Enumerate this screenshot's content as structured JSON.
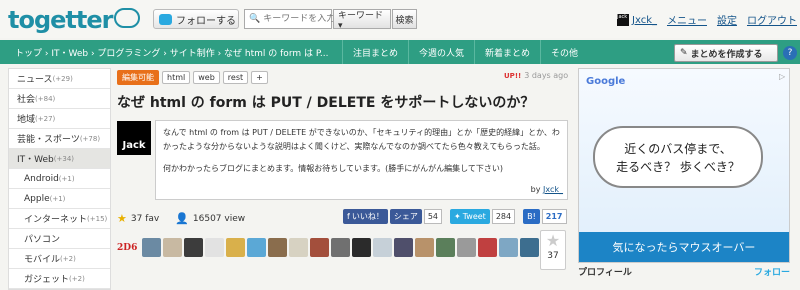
{
  "header": {
    "logo": "togetter",
    "follow": "フォローする",
    "search_placeholder": "キーワードを入力",
    "search_type": "キーワード ▾",
    "search_btn": "検索",
    "user_avatar": "Jack",
    "user_name": "Jxck_",
    "menu": "メニュー",
    "settings": "設定",
    "logout": "ログアウト"
  },
  "nav": {
    "breadcrumb": "トップ › IT・Web › プログラミング › サイト制作 › なぜ html の form は P...",
    "items": [
      "注目まとめ",
      "今週の人気",
      "新着まとめ",
      "その他"
    ],
    "create": "まとめを作成する",
    "help": "?"
  },
  "sidebar": [
    {
      "label": "ニュース",
      "count": "(+29)"
    },
    {
      "label": "社会",
      "count": "(+84)"
    },
    {
      "label": "地域",
      "count": "(+27)"
    },
    {
      "label": "芸能・スポーツ",
      "count": "(+78)"
    },
    {
      "label": "IT・Web",
      "count": "(+34)"
    },
    {
      "label": "Android",
      "count": "(+1)"
    },
    {
      "label": "Apple",
      "count": "(+1)"
    },
    {
      "label": "インターネット",
      "count": "(+15)"
    },
    {
      "label": "パソコン",
      "count": ""
    },
    {
      "label": "モバイル",
      "count": "(+2)"
    },
    {
      "label": "ガジェット",
      "count": "(+2)"
    }
  ],
  "article": {
    "edit_badge": "編集可能",
    "tags": [
      "html",
      "web",
      "rest",
      "+"
    ],
    "up_label": "UP!!",
    "time": "3 days ago",
    "title": "なぜ html の form は PUT / DELETE をサポートしないのか？",
    "author_avatar": "Jack",
    "desc1": "なんで html の from は PUT / DELETE ができないのか、「セキュリティ的理由」とか「歴史的経緯」とか、わかったような分からないような説明はよく聞くけど、実際なんでなのか調べてたら色々教えてもらった話。",
    "desc2": "何かわかったらブログにまとめます。情報お待ちしています。(勝手にがんがん編集して下さい)",
    "by": "by",
    "author": "Jxck_",
    "fav": "37 fav",
    "view": "16507 view",
    "fb_label": "いいね！",
    "share_label": "シェア",
    "share_count": "54",
    "tweet_label": "Tweet",
    "tweet_count": "284",
    "hatena_label": "B!",
    "hatena_count": "217",
    "favs_count_label": "2D6",
    "fav_box_count": "37"
  },
  "ad": {
    "brand": "Google",
    "line1": "近くのバス停まで、",
    "line2": "走るべき？ 歩くべき？",
    "cta": "気になったらマウスオーバー"
  },
  "profile": {
    "title": "プロフィール",
    "follow": "フォロー"
  },
  "colors": {
    "nav": "#2e9e83",
    "edit": "#e8701a",
    "link": "#14548a"
  }
}
